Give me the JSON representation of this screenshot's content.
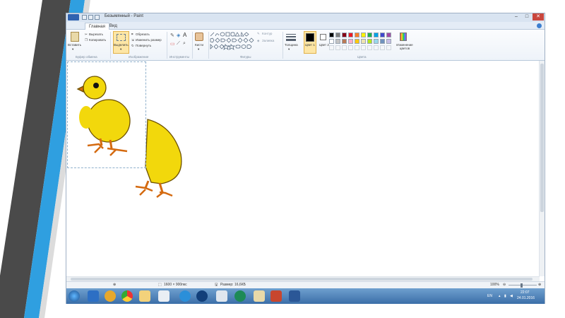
{
  "window": {
    "title": "Безымянный - Paint",
    "controls": {
      "minimize": "–",
      "maximize": "□",
      "close": "✕"
    }
  },
  "tabs": [
    {
      "label": "Главная"
    },
    {
      "label": "Вид"
    }
  ],
  "ribbon": {
    "clipboard": {
      "paste": "Вставить",
      "cut": "Вырезать",
      "copy": "Копировать",
      "group_label": "Буфер обмена"
    },
    "image": {
      "select": "Выделить",
      "crop": "Обрезать",
      "resize": "Изменить размер",
      "rotate": "Повернуть",
      "group_label": "Изображение"
    },
    "tools": {
      "group_label": "Инструменты"
    },
    "brushes": {
      "label": "Кисти"
    },
    "shapes": {
      "outline": "Контур",
      "fill": "Заливка",
      "group_label": "Фигуры"
    },
    "size": {
      "label": "Толщина"
    },
    "colors": {
      "color1_label": "Цвет 1",
      "color2_label": "Цвет 2",
      "edit_label": "Изменение цветов",
      "group_label": "Цвета",
      "color1": "#000000",
      "color2": "#ffffff",
      "palette_row1": [
        "#000000",
        "#7f7f7f",
        "#880015",
        "#ed1c24",
        "#ff7f27",
        "#fff200",
        "#22b14c",
        "#00a2e8",
        "#3f48cc",
        "#a349a4"
      ],
      "palette_row2": [
        "#ffffff",
        "#c3c3c3",
        "#b97a57",
        "#ffaec9",
        "#ffc90e",
        "#efe4b0",
        "#b5e61d",
        "#99d9ea",
        "#7092be",
        "#c8bfe7"
      ]
    }
  },
  "statusbar": {
    "dimensions": "1600 × 900пкс",
    "file_size": "Размер: 16,6КБ",
    "zoom": "100%"
  },
  "taskbar": {
    "language": "EN",
    "time": "22:07",
    "date": "24.01.2016"
  }
}
